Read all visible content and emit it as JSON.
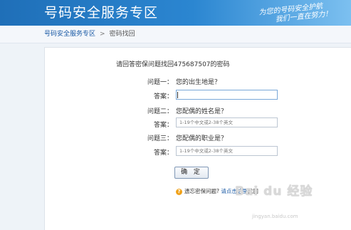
{
  "header": {
    "title": "号码安全服务专区",
    "slogan_line1": "为您的号码安全护航",
    "slogan_line2": "我们一直在努力！"
  },
  "breadcrumb": {
    "home": "号码安全服务专区",
    "separator": ">",
    "current": "密码找回"
  },
  "form": {
    "intro": "请回答密保问题找回475687507的密码",
    "questions": [
      {
        "label": "问题一：",
        "text": "您的出生地是？",
        "answer_label": "答案：",
        "value": "",
        "placeholder": ""
      },
      {
        "label": "问题二：",
        "text": "您配偶的姓名是？",
        "answer_label": "答案：",
        "value": "",
        "placeholder": "1-19个中文或2-38个英文"
      },
      {
        "label": "问题三：",
        "text": "您配偶的职业是？",
        "answer_label": "答案：",
        "value": "",
        "placeholder": "1-19个中文或2-38个英文"
      }
    ],
    "confirm_label": "确 定"
  },
  "help": {
    "prefix": "遗忘密保问题?",
    "link": "请点击这里",
    "suffix": "找回"
  },
  "watermark": {
    "logo": "Bai du 经验",
    "url": "jingyan.baidu.com"
  }
}
